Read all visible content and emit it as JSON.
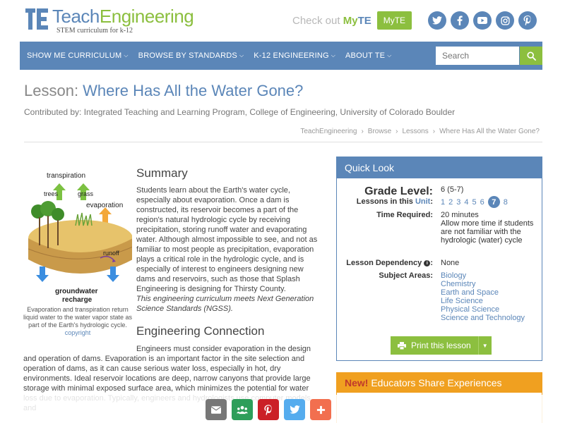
{
  "header": {
    "logo_teach": "Teach",
    "logo_eng": "Engineering",
    "logo_sub": "STEM curriculum for k-12",
    "myte_prefix": "Check out ",
    "myte_my": "My",
    "myte_te": "TE",
    "myte_button": "MyTE",
    "social": [
      "twitter-icon",
      "facebook-icon",
      "youtube-icon",
      "instagram-icon",
      "pinterest-icon"
    ]
  },
  "nav": {
    "items": [
      "SHOW ME CURRICULUM",
      "BROWSE BY STANDARDS",
      "K-12 ENGINEERING",
      "ABOUT TE"
    ],
    "search_placeholder": "Search"
  },
  "page": {
    "title_prefix": "Lesson: ",
    "title": "Where Has All the Water Gone?",
    "contributor": "Contributed by: Integrated Teaching and Learning Program, College of Engineering, University of Colorado Boulder",
    "breadcrumb": [
      "TeachEngineering",
      "Browse",
      "Lessons",
      "Where Has All the Water Gone?"
    ]
  },
  "illustration": {
    "labels": {
      "transpiration": "transpiration",
      "trees": "trees",
      "grass": "grass",
      "evaporation": "evaporation",
      "runoff": "runoff",
      "groundwater": "groundwater",
      "recharge": "recharge"
    },
    "caption": "Evaporation and transpiration return liquid water to the water vapor state as part of the Earth's hydrologic cycle.",
    "copyright": "copyright"
  },
  "summary": {
    "heading": "Summary",
    "body": "Students learn about the Earth's water cycle, especially about evaporation. Once a dam is constructed, its reservoir becomes a part of the region's natural hydrologic cycle by receiving precipitation, storing runoff water and evaporating water. Although almost impossible to see, and not as familiar to most people as precipitation, evaporation plays a critical role in the hydrologic cycle, and is especially of interest to engineers designing new dams and reservoirs, such as those that Splash Engineering is designing for Thirsty County.",
    "ngss": "This engineering curriculum meets Next Generation Science Standards (NGSS)."
  },
  "engineering": {
    "heading": "Engineering Connection",
    "body": "Engineers must consider evaporation in the design and operation of dams. Evaporation is an important factor in the site selection and operation of dams, as it can cause serious water loss, especially in hot, dry environments. Ideal reservoir locations are deep, narrow canyons that provide large storage with minimal exposed surface area, which minimizes the potential for water loss due to evaporation. Typically, engineers and hydrologists use computer models and"
  },
  "quicklook": {
    "heading": "Quick Look",
    "grade_label": "Grade Level:",
    "grade_value": "6 (5-7)",
    "lessons_label_pre": "Lessons in this ",
    "lessons_label_link": "Unit",
    "lessons_label_post": ":",
    "lessons": [
      "1",
      "2",
      "3",
      "4",
      "5",
      "6"
    ],
    "current_lesson": "7",
    "next_lesson": "8",
    "time_label": "Time Required:",
    "time_value": "20 minutes",
    "time_note": "Allow more time if students are not familiar with the hydrologic (water) cycle",
    "dependency_label": "Lesson Dependency",
    "dependency_value": "None",
    "subjects_label": "Subject Areas:",
    "subjects": [
      "Biology",
      "Chemistry",
      "Earth and Space",
      "Life Science",
      "Physical Science",
      "Science and Technology"
    ],
    "print_label": "Print this lesson"
  },
  "educators": {
    "new": "New!",
    "heading": " Educators Share Experiences"
  },
  "sharebar": {
    "buttons": [
      "email-icon",
      "google-classroom-icon",
      "pinterest-icon",
      "twitter-icon",
      "more-icon"
    ],
    "colors": [
      "#777777",
      "#2e9e5a",
      "#cb2027",
      "#55acee",
      "#f26f4f"
    ]
  }
}
